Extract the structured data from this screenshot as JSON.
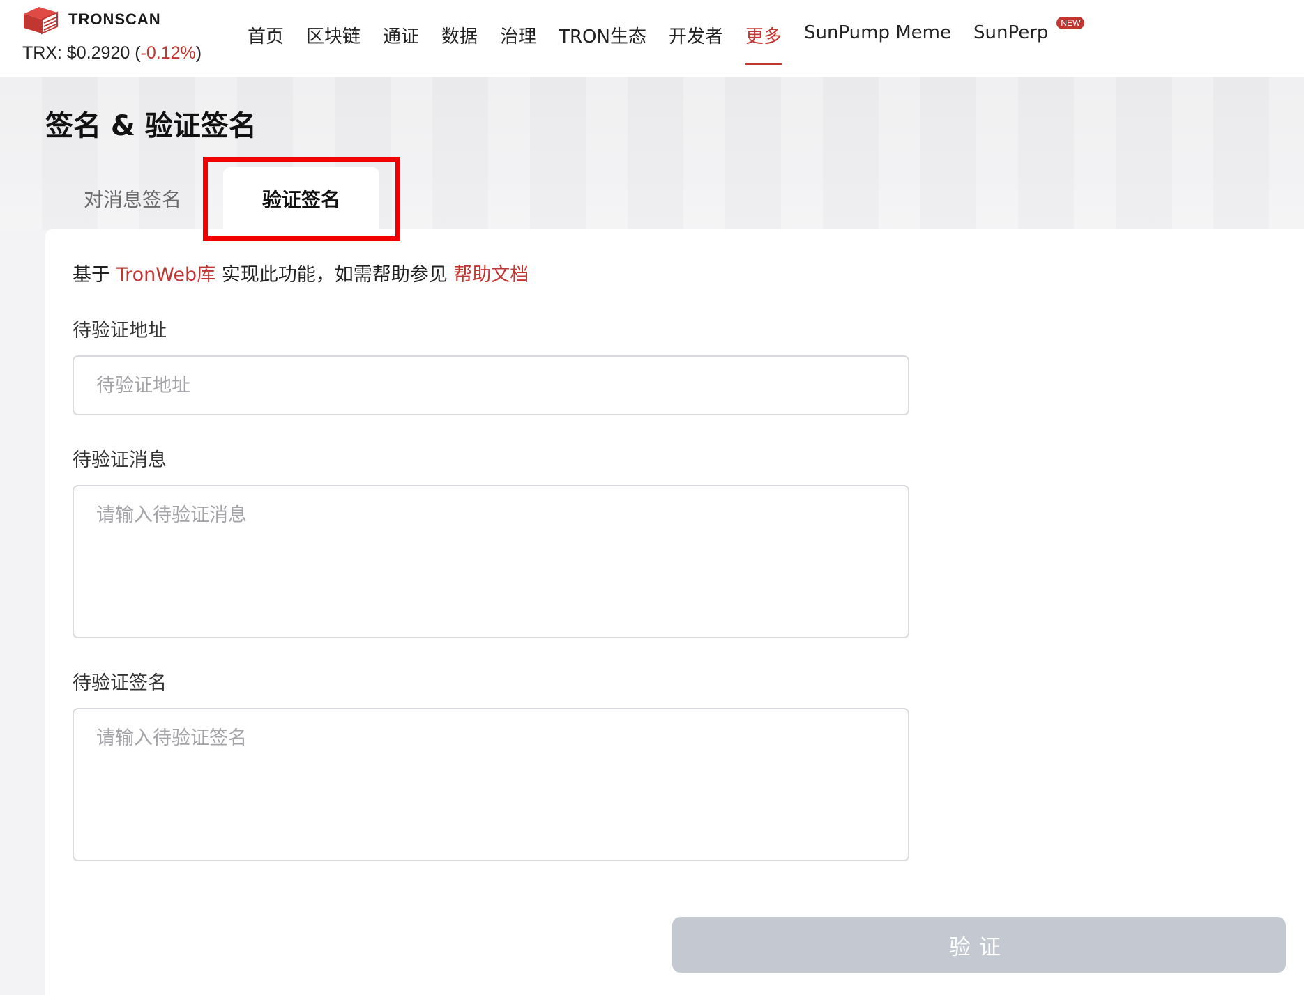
{
  "header": {
    "logo_text": "TRONSCAN",
    "price_prefix": "TRX: $0.2920 (",
    "price_change": "-0.12%",
    "price_suffix": ")",
    "nav": [
      {
        "label": "首页"
      },
      {
        "label": "区块链"
      },
      {
        "label": "通证"
      },
      {
        "label": "数据"
      },
      {
        "label": "治理"
      },
      {
        "label": "TRON生态"
      },
      {
        "label": "开发者"
      },
      {
        "label": "更多",
        "active": true
      },
      {
        "label": "SunPump Meme"
      },
      {
        "label": "SunPerp",
        "badge": "NEW"
      }
    ]
  },
  "page": {
    "title": "签名 & 验证签名",
    "tabs": [
      {
        "label": "对消息签名"
      },
      {
        "label": "验证签名",
        "active": true
      }
    ]
  },
  "form": {
    "intro_prefix": "基于 ",
    "intro_link1": "TronWeb库",
    "intro_middle": " 实现此功能，如需帮助参见 ",
    "intro_link2": "帮助文档",
    "address_label": "待验证地址",
    "address_placeholder": "待验证地址",
    "message_label": "待验证消息",
    "message_placeholder": "请输入待验证消息",
    "signature_label": "待验证签名",
    "signature_placeholder": "请输入待验证签名",
    "submit_label": "验证"
  },
  "colors": {
    "accent": "#c23631",
    "highlight": "#f00000",
    "button_disabled": "#c4c9d1"
  }
}
